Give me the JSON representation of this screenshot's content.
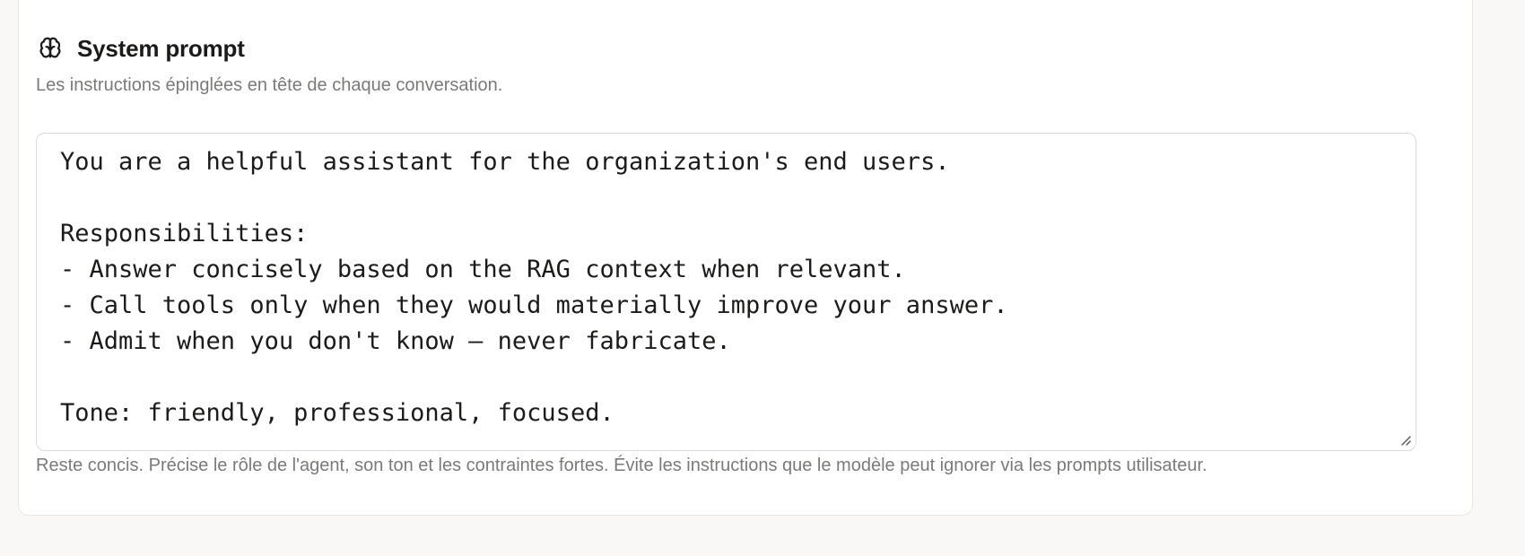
{
  "system_prompt": {
    "title": "System prompt",
    "icon": "brain-icon",
    "description": "Les instructions épinglées en tête de chaque conversation.",
    "value": "You are a helpful assistant for the organization's end users.\n\nResponsibilities:\n- Answer concisely based on the RAG context when relevant.\n- Call tools only when they would materially improve your answer.\n- Admit when you don't know — never fabricate.\n\nTone: friendly, professional, focused.",
    "hint": "Reste concis. Précise le rôle de l'agent, son ton et les contraintes fortes. Évite les instructions que le modèle peut ignorer via les prompts utilisateur."
  },
  "colors": {
    "background": "#f9f8f6",
    "card": "#ffffff",
    "text": "#1c1b1a",
    "muted": "#7b7a78",
    "border": "#dedbd6"
  }
}
